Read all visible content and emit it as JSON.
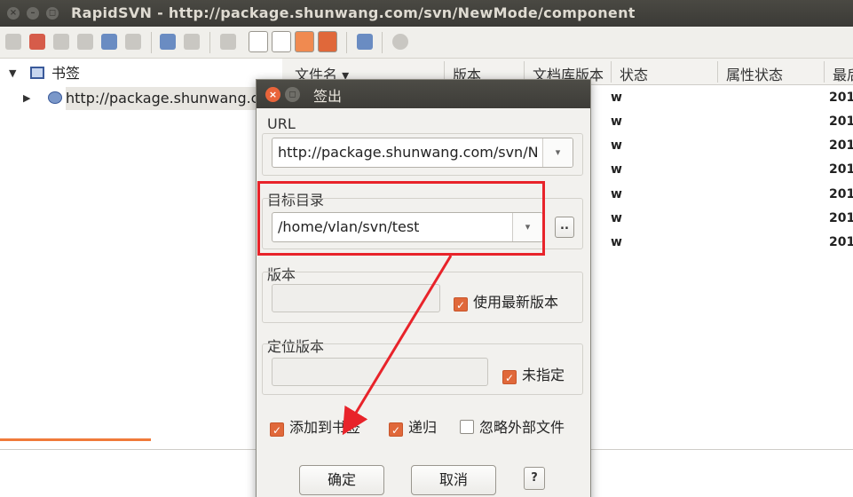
{
  "window": {
    "title": "RapidSVN - http://package.shunwang.com/svn/NewMode/component",
    "close_glyph": "×",
    "min_glyph": "–",
    "max_glyph": "◻"
  },
  "tree": {
    "bookmarks_label": "书签",
    "repo_label": "http://package.shunwang.com/"
  },
  "list": {
    "columns": [
      "文件名",
      "版本",
      "文档库版本",
      "状态",
      "属性状态",
      "最后"
    ],
    "rows": [
      {
        "status": "w",
        "date": "201"
      },
      {
        "status": "w",
        "date": "201"
      },
      {
        "status": "w",
        "date": "201"
      },
      {
        "status": "w",
        "date": "201"
      },
      {
        "status": "w",
        "date": "201"
      },
      {
        "status": "w",
        "date": "201"
      },
      {
        "status": "w",
        "date": "201"
      }
    ]
  },
  "dialog": {
    "title": "签出",
    "close_glyph": "×",
    "max_glyph": "◻",
    "url": {
      "label": "URL",
      "value": "http://package.shunwang.com/svn/N"
    },
    "target": {
      "label": "目标目录",
      "value": "/home/vlan/svn/test",
      "browse_label": ".."
    },
    "revision": {
      "label": "版本",
      "value": "",
      "latest_checkbox": {
        "label": "使用最新版本",
        "checked": true
      }
    },
    "peg": {
      "label": "定位版本",
      "value": "",
      "unspecified_checkbox": {
        "label": "未指定",
        "checked": true
      }
    },
    "options": {
      "add_bookmark": {
        "label": "添加到书签",
        "checked": true
      },
      "recursive": {
        "label": "递归",
        "checked": true
      },
      "ignore_externals": {
        "label": "忽略外部文件",
        "checked": false
      }
    },
    "ok_label": "确定",
    "cancel_label": "取消",
    "help_label": "?"
  },
  "glyphs": {
    "dropdown": "▾",
    "check": "✓",
    "expand_open": "▼",
    "expand_closed": "▶",
    "sort_desc": "▾"
  },
  "colors": {
    "accent": "#e0683a",
    "annotation": "#e8232a"
  }
}
